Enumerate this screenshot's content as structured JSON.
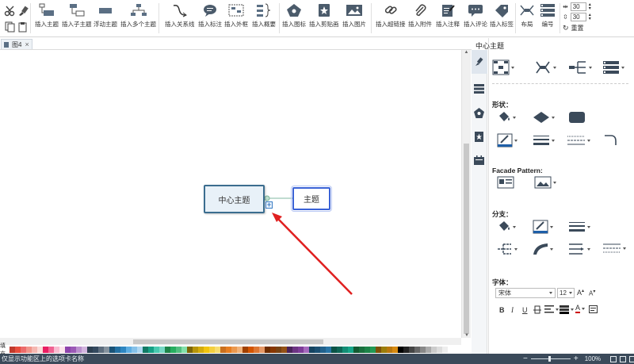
{
  "ribbon": {
    "insert_topic": "插入主题",
    "insert_subtopic": "插入子主题",
    "float_topic": "浮动主题",
    "multi_topic": "插入多个主题",
    "relation": "插入关系线",
    "callout": "插入标注",
    "boundary": "插入外框",
    "summary": "插入概要",
    "icon": "插入图标",
    "clipart": "插入剪贴画",
    "picture": "插入图片",
    "hyperlink": "插入超链接",
    "attachment": "插入附件",
    "note": "插入注释",
    "comment": "插入评论",
    "tag": "插入标签",
    "layout": "布局",
    "numbering": "编号",
    "spacing_h": "30",
    "spacing_v": "30",
    "reset": "重置"
  },
  "tab": {
    "label": "图4"
  },
  "canvas": {
    "central_topic": "中心主题",
    "sub_topic": "主题"
  },
  "panel": {
    "title": "中心主题",
    "shape_label": "形状：",
    "facade_label": "Facade Pattern:",
    "branch_label": "分支：",
    "font_label": "字体：",
    "font_family": "宋体",
    "font_size": "12",
    "grow_font": "A",
    "shrink_font": "A",
    "bold": "B",
    "italic": "I",
    "underline": "U",
    "font_color": "A"
  },
  "palette": {
    "label": "填充",
    "colors": [
      "#c0392b",
      "#e74c3c",
      "#ec6b6b",
      "#f1948a",
      "#f5b7b1",
      "#fadbd8",
      "#e91e63",
      "#f06292",
      "#f8bbd0",
      "#fce4ec",
      "#8e44ad",
      "#9b59b6",
      "#bb8fce",
      "#d2b4de",
      "#2c3e50",
      "#34495e",
      "#5d6d7e",
      "#85929e",
      "#1a5276",
      "#2471a3",
      "#2e86c1",
      "#5dade2",
      "#85c1e9",
      "#aed6f1",
      "#117a65",
      "#16a085",
      "#48c9b0",
      "#76d7c4",
      "#1e8449",
      "#27ae60",
      "#52be80",
      "#82e0aa",
      "#7d6608",
      "#b7950b",
      "#d4ac0d",
      "#f1c40f",
      "#f4d03f",
      "#f7dc6f",
      "#ca6f1e",
      "#e67e22",
      "#eb984e",
      "#f0b27a",
      "#a04000",
      "#d35400",
      "#dc7633",
      "#e59866",
      "#6e2c00",
      "#873600",
      "#784212",
      "#935116",
      "#4a235a",
      "#6c3483",
      "#7d3c98",
      "#a569bd",
      "#154360",
      "#1b4f72",
      "#21618c",
      "#2874a6",
      "#0b5345",
      "#0e6655",
      "#138d75",
      "#17a589",
      "#145a32",
      "#196f3d",
      "#1d8348",
      "#229954",
      "#7e5109",
      "#9a7d0a",
      "#b9770e",
      "#d68910",
      "#000000",
      "#222222",
      "#444444",
      "#666666",
      "#888888",
      "#aaaaaa",
      "#cccccc",
      "#dddddd",
      "#eeeeee",
      "#ffffff"
    ]
  },
  "status": {
    "message": "仅显示功能区上的选项卡名称",
    "zoom": "100%"
  }
}
